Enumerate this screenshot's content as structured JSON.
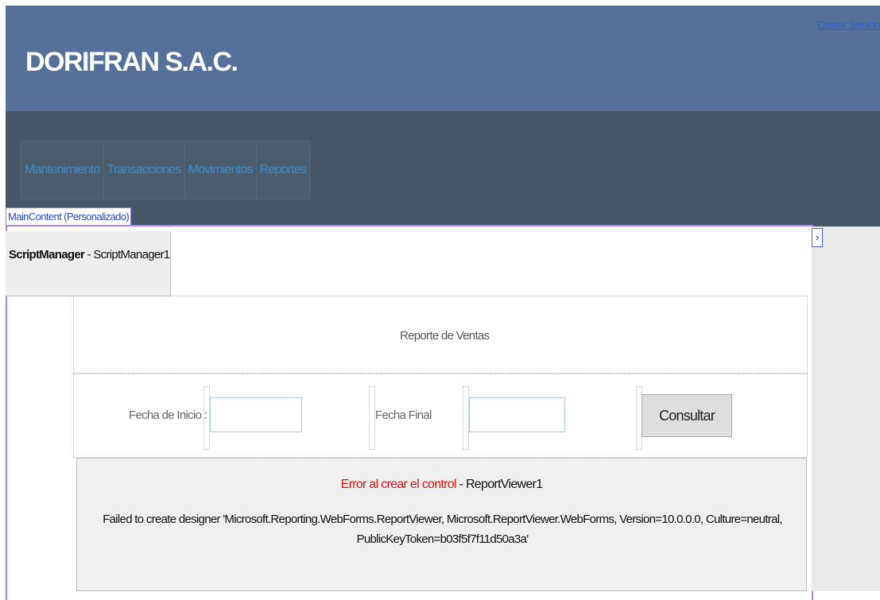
{
  "header": {
    "site_title": "DORIFRAN S.A.C.",
    "logout_label": "Cerrar Sesión"
  },
  "nav": {
    "items": [
      {
        "label": "Mantenimiento"
      },
      {
        "label": "Transacciones"
      },
      {
        "label": "Movimientos"
      },
      {
        "label": "Reportes"
      }
    ]
  },
  "designer": {
    "content_placeholder_tag": "MainContent (Personalizado)",
    "script_manager": {
      "type": "ScriptManager",
      "separator": " - ",
      "id": "ScriptManager1"
    },
    "expand_glyph": "›"
  },
  "report": {
    "title": "Reporte de Ventas",
    "start_date_label": "Fecha de Inicio :",
    "end_date_label": "Fecha Final",
    "start_date_value": "",
    "end_date_value": "",
    "consult_label": "Consultar"
  },
  "error_panel": {
    "error_title": "Error al crear el control",
    "separator": " - ",
    "control_id": "ReportViewer1",
    "message": "Failed to create designer 'Microsoft.Reporting.WebForms.ReportViewer, Microsoft.ReportViewer.WebForms, Version=10.0.0.0, Culture=neutral, PublicKeyToken=b03f5f7f11d50a3a'"
  },
  "colors": {
    "header_bg": "#566f9b",
    "menu_bg": "#465868",
    "nav_text": "#3f8ac6",
    "frame_border": "#a980ff",
    "error_red": "#e01313",
    "link_blue": "#2f5fd6"
  }
}
